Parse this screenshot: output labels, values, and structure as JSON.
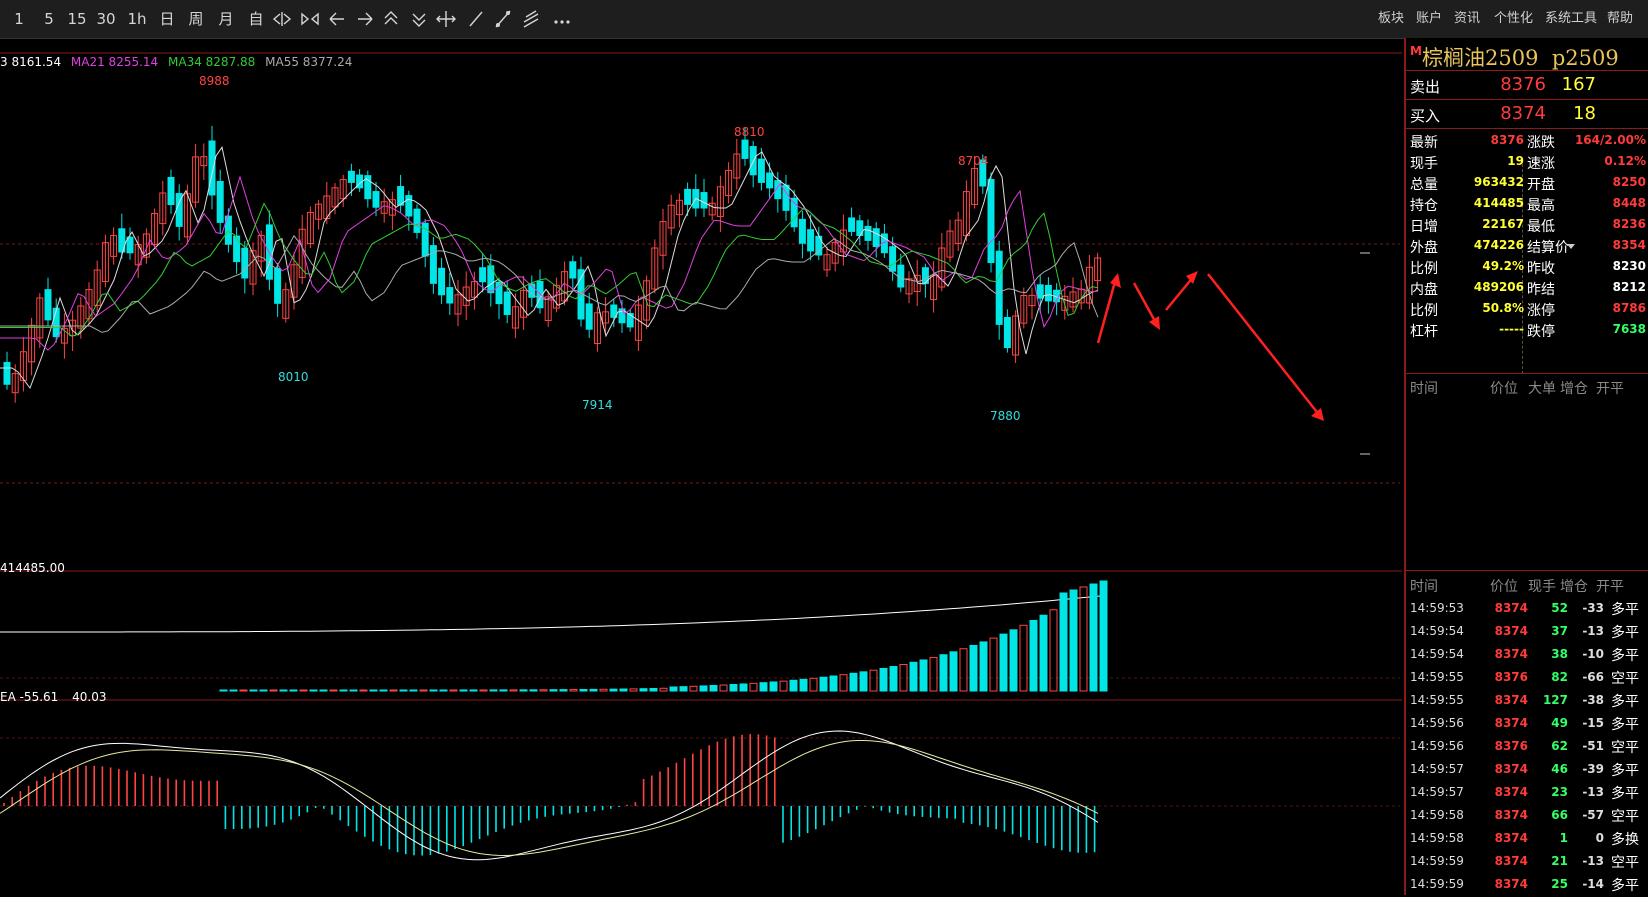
{
  "toolbar": {
    "periods": [
      "1",
      "5",
      "15",
      "30",
      "1h",
      "日",
      "周",
      "月",
      "自"
    ],
    "menu": [
      "板块",
      "账户",
      "资讯",
      "个性化",
      "系统工具",
      "帮助"
    ]
  },
  "chart": {
    "ma_legend": [
      {
        "label": "3 8161.54",
        "color": "#ffffff"
      },
      {
        "label": "MA21 8255.14",
        "color": "#e040e0"
      },
      {
        "label": "MA34 8287.88",
        "color": "#33cc33"
      },
      {
        "label": "MA55 8377.24",
        "color": "#aaaaaa"
      }
    ],
    "peaks": [
      {
        "label": "8988",
        "color": "#ff4444"
      },
      {
        "label": "8810",
        "color": "#ff4444"
      },
      {
        "label": "8704",
        "color": "#ff4444"
      },
      {
        "label": "8010",
        "color": "#33dddd"
      },
      {
        "label": "7914",
        "color": "#33dddd"
      },
      {
        "label": "7880",
        "color": "#33dddd"
      }
    ],
    "oi_label": "414485.00",
    "macd_label": "EA -55.61",
    "macd_value": "40.03"
  },
  "panel": {
    "badge": "M",
    "contract": "棕榈油2509",
    "code": "p2509",
    "ask": {
      "label": "卖出",
      "price": "8376",
      "vol": "167"
    },
    "bid": {
      "label": "买入",
      "price": "8374",
      "vol": "18"
    },
    "quotes": [
      {
        "l1": "最新",
        "v1": "8376",
        "c1": "#ff3b3b",
        "l2": "涨跌",
        "v2": "164/2.00%",
        "c2": "#ff3b3b"
      },
      {
        "l1": "现手",
        "v1": "19",
        "c1": "#ffff33",
        "l2": "速涨",
        "v2": "0.12%",
        "c2": "#ff3b3b"
      },
      {
        "l1": "总量",
        "v1": "963432",
        "c1": "#ffff33",
        "l2": "开盘",
        "v2": "8250",
        "c2": "#ff3b3b"
      },
      {
        "l1": "持仓",
        "v1": "414485",
        "c1": "#ffff33",
        "l2": "最高",
        "v2": "8448",
        "c2": "#ff3b3b"
      },
      {
        "l1": "日增",
        "v1": "22167",
        "c1": "#ffff33",
        "l2": "最低",
        "v2": "8236",
        "c2": "#ff3b3b"
      },
      {
        "l1": "外盘",
        "v1": "474226",
        "c1": "#ffff33",
        "l2": "结算价",
        "v2": "8354",
        "c2": "#ff3b3b"
      },
      {
        "l1": "比例",
        "v1": "49.2%",
        "c1": "#ffff33",
        "l2": "昨收",
        "v2": "8230",
        "c2": "#ffffff"
      },
      {
        "l1": "内盘",
        "v1": "489206",
        "c1": "#ffff33",
        "l2": "昨结",
        "v2": "8212",
        "c2": "#ffffff"
      },
      {
        "l1": "比例",
        "v1": "50.8%",
        "c1": "#ffff33",
        "l2": "涨停",
        "v2": "8786",
        "c2": "#ff3b3b"
      },
      {
        "l1": "杠杆",
        "v1": "-----",
        "c1": "#ffff33",
        "l2": "跌停",
        "v2": "7638",
        "c2": "#33ff66"
      }
    ],
    "header1": [
      "时间",
      "价位",
      "大单",
      "增仓",
      "开平"
    ],
    "header2": [
      "时间",
      "价位",
      "现手",
      "增仓",
      "开平"
    ],
    "ticks": [
      {
        "time": "14:59:53",
        "price": "8374",
        "vol": "52",
        "oi": "-33",
        "type": "多平"
      },
      {
        "time": "14:59:54",
        "price": "8374",
        "vol": "37",
        "oi": "-13",
        "type": "多平"
      },
      {
        "time": "14:59:54",
        "price": "8374",
        "vol": "38",
        "oi": "-10",
        "type": "多平"
      },
      {
        "time": "14:59:55",
        "price": "8376",
        "vol": "82",
        "oi": "-66",
        "type": "空平"
      },
      {
        "time": "14:59:55",
        "price": "8374",
        "vol": "127",
        "oi": "-38",
        "type": "多平"
      },
      {
        "time": "14:59:56",
        "price": "8374",
        "vol": "49",
        "oi": "-15",
        "type": "多平"
      },
      {
        "time": "14:59:56",
        "price": "8376",
        "vol": "62",
        "oi": "-51",
        "type": "空平"
      },
      {
        "time": "14:59:57",
        "price": "8374",
        "vol": "46",
        "oi": "-39",
        "type": "多平"
      },
      {
        "time": "14:59:57",
        "price": "8374",
        "vol": "23",
        "oi": "-13",
        "type": "多平"
      },
      {
        "time": "14:59:58",
        "price": "8374",
        "vol": "66",
        "oi": "-57",
        "type": "空平"
      },
      {
        "time": "14:59:58",
        "price": "8374",
        "vol": "1",
        "oi": "0",
        "type": "多换"
      },
      {
        "time": "14:59:59",
        "price": "8374",
        "vol": "21",
        "oi": "-13",
        "type": "空平"
      },
      {
        "time": "14:59:59",
        "price": "8374",
        "vol": "25",
        "oi": "-14",
        "type": "多平"
      }
    ]
  },
  "colors": {
    "up": "#ff4444",
    "down": "#00e5e5",
    "panel_border": "#8b1a1a"
  }
}
